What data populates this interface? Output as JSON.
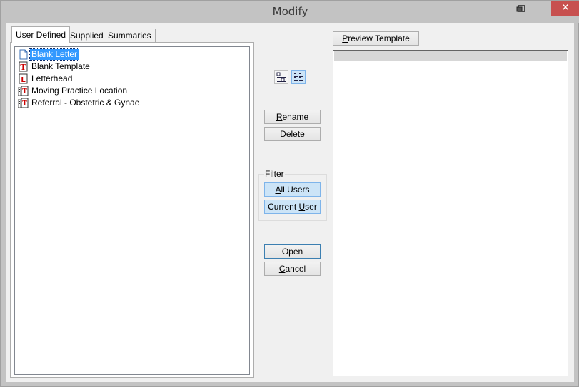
{
  "window": {
    "title": "Modify",
    "close_glyph": "✕"
  },
  "tabs": [
    {
      "label": "User Defined",
      "active": true
    },
    {
      "label": "Supplied",
      "active": false
    },
    {
      "label": "Summaries",
      "active": false
    }
  ],
  "templates": [
    {
      "label": "Blank Letter",
      "icon": "blank-letter-icon",
      "selected": true
    },
    {
      "label": "Blank Template",
      "icon": "template-t-icon",
      "selected": false
    },
    {
      "label": "Letterhead",
      "icon": "letterhead-icon",
      "selected": false
    },
    {
      "label": "Moving Practice Location",
      "icon": "linked-template-icon",
      "selected": false
    },
    {
      "label": "Referral - Obstetric & Gynae",
      "icon": "linked-template-icon",
      "selected": false
    }
  ],
  "view_buttons": [
    {
      "name": "view-small-icons-button",
      "icon": "small-icons-icon",
      "active": false
    },
    {
      "name": "view-details-button",
      "icon": "details-list-icon",
      "active": true
    }
  ],
  "actions": {
    "rename_pre": "",
    "rename_key": "R",
    "rename_post": "ename",
    "delete_pre": "",
    "delete_key": "D",
    "delete_post": "elete"
  },
  "filter": {
    "label": "Filter",
    "all_users_pre": "",
    "all_users_key": "A",
    "all_users_post": "ll Users",
    "current_user_pre": "Current ",
    "current_user_key": "U",
    "current_user_post": "ser"
  },
  "open_label": "Open",
  "cancel": {
    "pre": "",
    "key": "C",
    "post": "ancel"
  },
  "preview": {
    "pre": "",
    "key": "P",
    "post": "review Template"
  },
  "colors": {
    "selection": "#3399ff",
    "close": "#c7504f",
    "pressed": "#cce4f7"
  }
}
